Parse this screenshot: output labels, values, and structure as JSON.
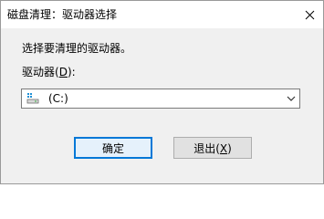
{
  "window": {
    "title": "磁盘清理：驱动器选择"
  },
  "dialog": {
    "prompt": "选择要清理的驱动器。",
    "drive_label_prefix": "驱动器(",
    "drive_label_mnemonic": "D",
    "drive_label_suffix": "):",
    "selected_drive": "(C:)",
    "icons": {
      "drive": "drive-icon",
      "dropdown": "chevron-down-icon",
      "close": "close-icon"
    }
  },
  "buttons": {
    "ok_label": "确定",
    "cancel_label_prefix": "退出(",
    "cancel_label_mnemonic": "X",
    "cancel_label_suffix": ")"
  },
  "colors": {
    "accent": "#0078d7",
    "dialog_background": "#f0f0f0"
  }
}
